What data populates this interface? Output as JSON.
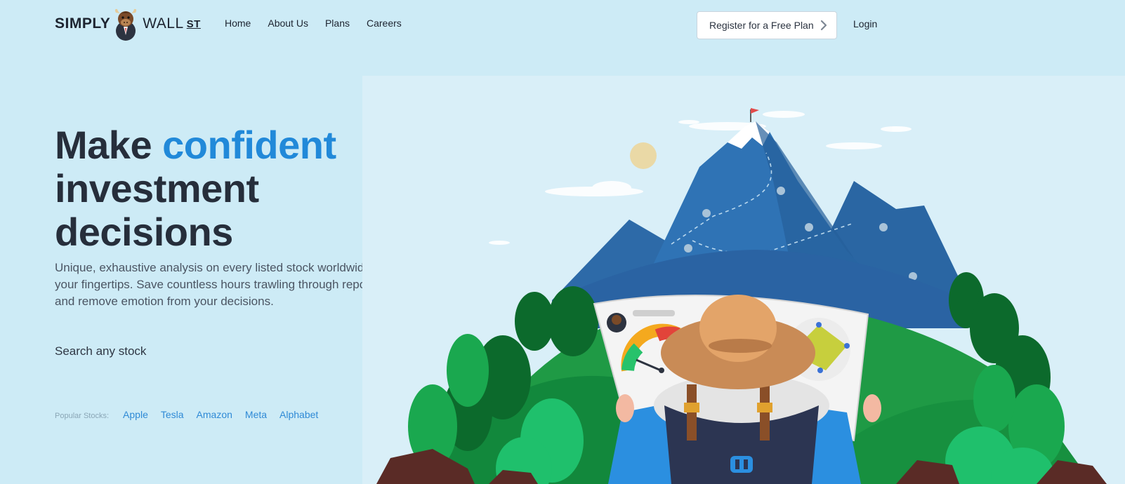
{
  "brand": {
    "word1": "SIMPLY",
    "word2": "WALL",
    "word3": "ST"
  },
  "nav": {
    "home": "Home",
    "about": "About Us",
    "plans": "Plans",
    "careers": "Careers"
  },
  "header": {
    "register_label": "Register for a Free Plan",
    "login_label": "Login"
  },
  "hero": {
    "headline_part1": "Make",
    "headline_accent": "confident",
    "headline_line2": "investment",
    "headline_line3": "decisions",
    "subtext": "Unique, exhaustive analysis on every listed stock worldwide at your fingertips. Save countless hours trawling through reports and remove emotion from your decisions.",
    "search_label": "Search any stock"
  },
  "popular": {
    "label": "Popular Stocks:",
    "stocks": [
      "Apple",
      "Tesla",
      "Amazon",
      "Meta",
      "Alphabet"
    ]
  },
  "colors": {
    "background": "#cdebf6",
    "accent": "#2189d9",
    "headline": "#262e3b",
    "link": "#2f8ad6"
  },
  "icons": {
    "register_chevron": "chevron-right-icon",
    "logo_mascot": "bull-mascot-icon"
  }
}
